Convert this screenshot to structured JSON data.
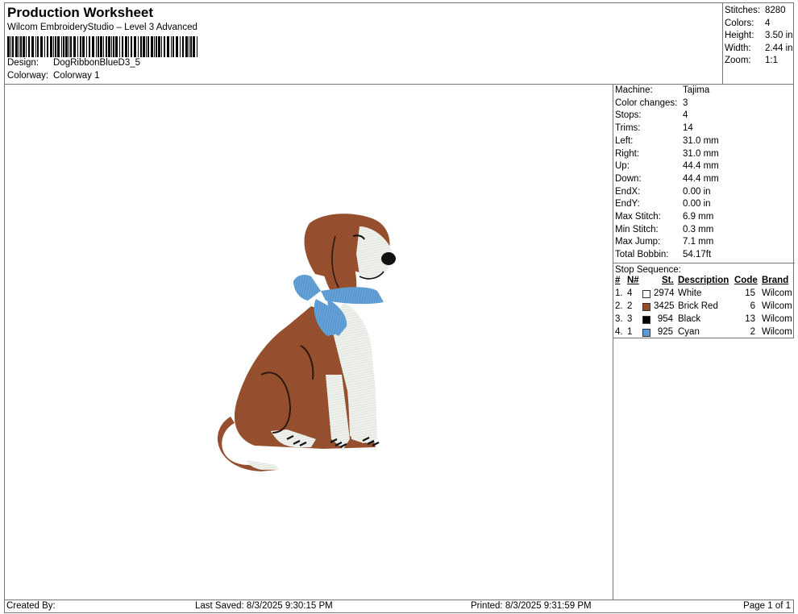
{
  "header": {
    "title": "Production Worksheet",
    "subtitle": "Wilcom EmbroideryStudio – Level 3 Advanced",
    "design_label": "Design:",
    "design_value": "DogRibbonBlueD3_5",
    "colorway_label": "Colorway:",
    "colorway_value": "Colorway 1"
  },
  "summary": [
    {
      "label": "Stitches:",
      "value": "8280"
    },
    {
      "label": "Colors:",
      "value": "4"
    },
    {
      "label": "Height:",
      "value": "3.50 in"
    },
    {
      "label": "Width:",
      "value": "2.44 in"
    },
    {
      "label": "Zoom:",
      "value": "1:1"
    }
  ],
  "details": [
    {
      "label": "Machine:",
      "value": "Tajima"
    },
    {
      "label": "Color changes:",
      "value": "3"
    },
    {
      "label": "Stops:",
      "value": "4"
    },
    {
      "label": "Trims:",
      "value": "14"
    },
    {
      "label": "Left:",
      "value": "31.0 mm"
    },
    {
      "label": "Right:",
      "value": "31.0 mm"
    },
    {
      "label": "Up:",
      "value": "44.4 mm"
    },
    {
      "label": "Down:",
      "value": "44.4 mm"
    },
    {
      "label": "EndX:",
      "value": "0.00 in"
    },
    {
      "label": "EndY:",
      "value": "0.00 in"
    },
    {
      "label": "Max Stitch:",
      "value": "6.9 mm"
    },
    {
      "label": "Min Stitch:",
      "value": "0.3 mm"
    },
    {
      "label": "Max Jump:",
      "value": "7.1 mm"
    },
    {
      "label": "Total Bobbin:",
      "value": "54.17ft"
    }
  ],
  "stop_sequence": {
    "title": "Stop Sequence:",
    "columns": [
      "#",
      "N#",
      "St.",
      "Description",
      "Code",
      "Brand"
    ],
    "rows": [
      {
        "idx": "1.",
        "n": "4",
        "color": "#ffffff",
        "st": "2974",
        "desc": "White",
        "code": "15",
        "brand": "Wilcom"
      },
      {
        "idx": "2.",
        "n": "2",
        "color": "#9a4a2a",
        "st": "3425",
        "desc": "Brick Red",
        "code": "6",
        "brand": "Wilcom"
      },
      {
        "idx": "3.",
        "n": "3",
        "color": "#000000",
        "st": "954",
        "desc": "Black",
        "code": "13",
        "brand": "Wilcom"
      },
      {
        "idx": "4.",
        "n": "1",
        "color": "#5b9bd5",
        "st": "925",
        "desc": "Cyan",
        "code": "2",
        "brand": "Wilcom"
      }
    ]
  },
  "footer": {
    "created_by": "Created By:",
    "last_saved": "Last Saved: 8/3/2025 9:30:15 PM",
    "printed": "Printed: 8/3/2025 9:31:59 PM",
    "page": "Page 1 of 1"
  }
}
